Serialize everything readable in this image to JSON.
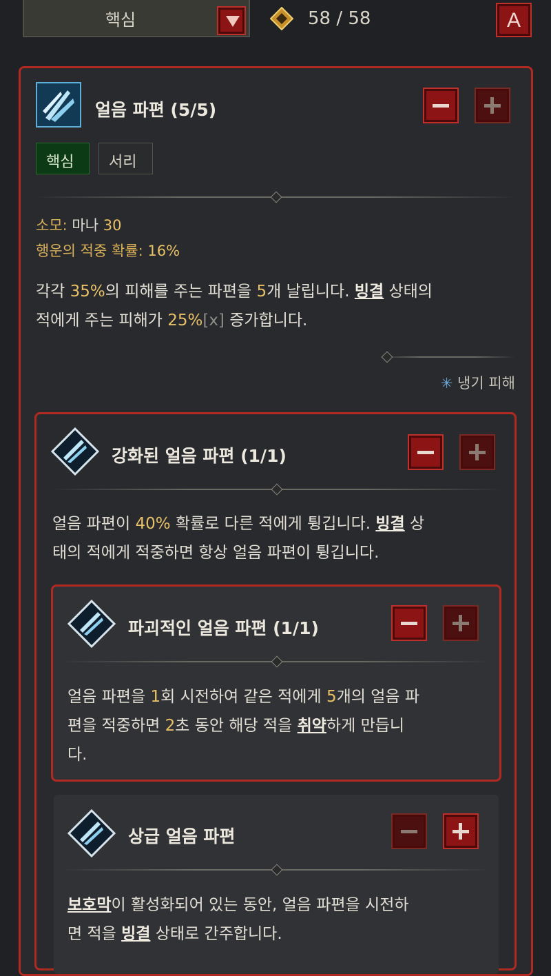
{
  "header": {
    "category": "핵심",
    "points": "58 / 58",
    "a_button": "A"
  },
  "skill": {
    "name": "얼음 파편 (5/5)",
    "tags": [
      "핵심",
      "서리"
    ],
    "cost_label": "소모:",
    "cost_value_text": "마나",
    "cost_value": "30",
    "luck_label": "행운의 적중 확률:",
    "luck_value": "16%",
    "desc": {
      "p1": "각각 ",
      "v1": "35%",
      "p2": "의 피해를 주는 파편을 ",
      "v2": "5",
      "p3": "개 날립니다. ",
      "k1": "빙결",
      "p4": " 상태의",
      "p5": "적에게 주는 피해가 ",
      "v3": "25%",
      "x": "[x]",
      "p6": " 증가합니다."
    },
    "damage_type": "냉기 피해"
  },
  "upgrade1": {
    "name": "강화된 얼음 파편 (1/1)",
    "line1_a": "얼음 파편이 ",
    "line1_v": "40%",
    "line1_b": " 확률로 다른 적에게 튕깁니다. ",
    "line1_k": "빙결",
    "line1_c": " 상",
    "line2": "태의 적에게 적중하면 항상 얼음 파편이 튕깁니다."
  },
  "upgrade2": {
    "name": "파괴적인 얼음 파편 (1/1)",
    "l1_a": "얼음 파편을 ",
    "l1_v1": "1",
    "l1_b": "회 시전하여 같은 적에게 ",
    "l1_v2": "5",
    "l1_c": "개의 얼음 파",
    "l2_a": "편을 적중하면 ",
    "l2_v": "2",
    "l2_b": "초 동안 해당 적을 ",
    "l2_k": "취약",
    "l2_c": "하게 만듭니",
    "l3": "다."
  },
  "upgrade3": {
    "name": "상급 얼음 파편",
    "l1_k": "보호막",
    "l1_a": "이 활성화되어 있는 동안, 얼음 파편을 시전하",
    "l2_a": "면 적을 ",
    "l2_k": "빙결",
    "l2_b": " 상태로 간주합니다."
  },
  "icons": [
    "chevron-down-icon",
    "diamond-points-icon",
    "ice-shards-icon",
    "minus-icon",
    "plus-icon",
    "snowflake-icon"
  ],
  "colors": {
    "accent_red": "#b02a22",
    "value_gold": "#e8c065",
    "core_tag_green": "#0c3a14",
    "ice_blue": "#5fb0d8"
  }
}
